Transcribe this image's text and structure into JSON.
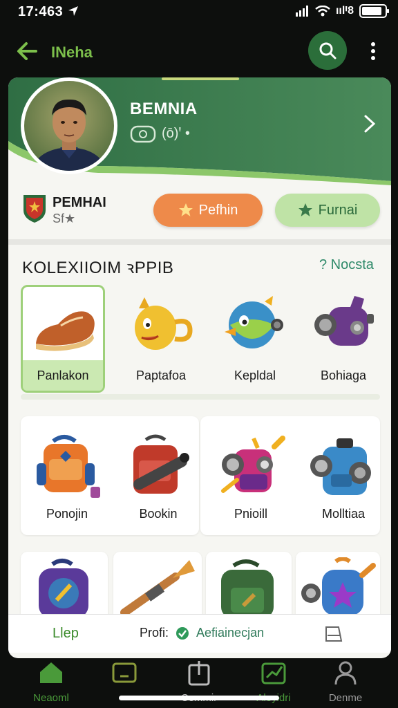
{
  "status_bar": {
    "time": "17:463",
    "carrier": "ıılꞋ8"
  },
  "app_bar": {
    "title": "INeha"
  },
  "hero": {
    "name": "BEMNIA",
    "sub": "(ō)ꞌ •"
  },
  "profile": {
    "name": "PEMHAI",
    "sub": "Sf★",
    "primary_button": "Pefhin",
    "secondary_button": "Furnai"
  },
  "collection": {
    "title": "KOLEXIIOIM ꝛPPIB",
    "link": "? Nocsta",
    "rows": [
      [
        {
          "label": "Panlakon",
          "icon": "sneaker-icon",
          "selected": true
        },
        {
          "label": "Paptafoa",
          "icon": "yellow-creature-icon",
          "selected": false
        },
        {
          "label": "Kepldal",
          "icon": "blue-bird-icon",
          "selected": false
        },
        {
          "label": "Bohiaga",
          "icon": "purple-robot-icon",
          "selected": false
        }
      ],
      [
        {
          "label": "Ponojin",
          "icon": "orange-backpack-icon"
        },
        {
          "label": "Bookin",
          "icon": "red-bag-icon"
        },
        {
          "label": "Pnioill",
          "icon": "pink-gadget-icon"
        },
        {
          "label": "Molltiaa",
          "icon": "blue-camera-icon"
        }
      ],
      [
        {
          "label": "",
          "icon": "purple-backpack-icon"
        },
        {
          "label": "",
          "icon": "trumpet-icon"
        },
        {
          "label": "",
          "icon": "green-backpack-icon"
        },
        {
          "label": "",
          "icon": "blue-star-gadget-icon"
        }
      ]
    ]
  },
  "strip": {
    "left": "Llep",
    "profile_label": "Profi:",
    "status": "Aefiainecjan"
  },
  "nav": [
    {
      "label": "Neaoml",
      "icon": "home-icon",
      "active": true
    },
    {
      "label": "",
      "icon": "tv-icon",
      "active": false
    },
    {
      "label": "Cemmir",
      "icon": "share-icon",
      "active": false
    },
    {
      "label": "Aleyidri",
      "icon": "chart-icon",
      "active": false
    },
    {
      "label": "Denme",
      "icon": "user-icon",
      "active": false
    }
  ],
  "colors": {
    "hero_green": "#3d7a4f",
    "accent_green": "#7cbf4b",
    "orange": "#ee8a4a",
    "light_green": "#bfe3a6"
  }
}
